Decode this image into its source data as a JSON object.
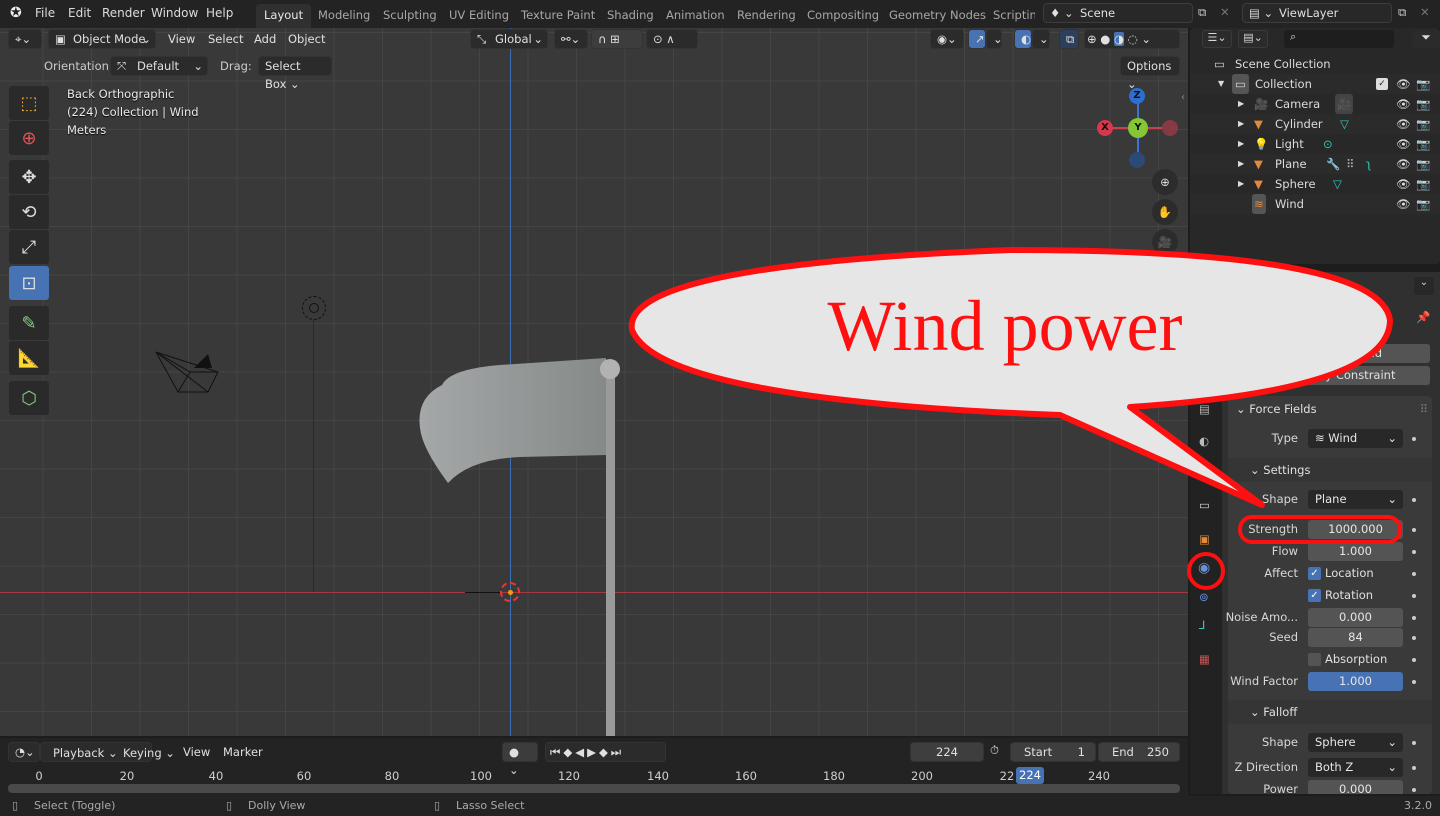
{
  "topbar": {
    "menus": [
      "File",
      "Edit",
      "Render",
      "Window",
      "Help"
    ],
    "workspaces": [
      "Layout",
      "Modeling",
      "Sculpting",
      "UV Editing",
      "Texture Paint",
      "Shading",
      "Animation",
      "Rendering",
      "Compositing",
      "Geometry Nodes",
      "Scripting"
    ],
    "active_workspace": "Layout",
    "scene": "Scene",
    "view_layer": "ViewLayer"
  },
  "viewport_header": {
    "mode": "Object Mode",
    "menus": [
      "View",
      "Select",
      "Add",
      "Object"
    ],
    "transform_orientation": "Global",
    "orientation_label": "Orientation:",
    "orientation_value": "Default",
    "drag_label": "Drag:",
    "drag_value": "Select Box",
    "options": "Options"
  },
  "viewport_overlay": {
    "view_name": "Back Orthographic",
    "context": "(224) Collection | Wind",
    "units": "Meters"
  },
  "gizmo": {
    "z": "Z",
    "y": "Y",
    "x": "X"
  },
  "callout": {
    "text": "Wind power",
    "color": "#ff1010"
  },
  "outliner": {
    "root": "Scene Collection",
    "collection": "Collection",
    "objects": [
      {
        "name": "Camera",
        "type": "camera"
      },
      {
        "name": "Cylinder",
        "type": "mesh"
      },
      {
        "name": "Light",
        "type": "light"
      },
      {
        "name": "Plane",
        "type": "mesh"
      },
      {
        "name": "Sphere",
        "type": "mesh"
      },
      {
        "name": "Wind",
        "type": "force"
      }
    ]
  },
  "properties": {
    "buttons": [
      "Field",
      "Rigid Body Constraint"
    ],
    "panel": "Force Fields",
    "type_label": "Type",
    "type_value": "Wind",
    "settings_label": "Settings",
    "shape_label": "Shape",
    "shape_value": "Plane",
    "strength_label": "Strength",
    "strength_value": "1000.000",
    "flow_label": "Flow",
    "flow_value": "1.000",
    "affect_label": "Affect",
    "affect_location": "Location",
    "affect_rotation": "Rotation",
    "noise_label": "Noise Amo...",
    "noise_value": "0.000",
    "seed_label": "Seed",
    "seed_value": "84",
    "absorption_label": "Absorption",
    "wind_factor_label": "Wind Factor",
    "wind_factor_value": "1.000",
    "falloff_label": "Falloff",
    "falloff_shape_label": "Shape",
    "falloff_shape_value": "Sphere",
    "zdir_label": "Z Direction",
    "zdir_value": "Both Z",
    "power_label": "Power",
    "power_value": "0.000"
  },
  "timeline": {
    "menus": [
      "Playback",
      "Keying",
      "View",
      "Marker"
    ],
    "current_frame": "224",
    "start_label": "Start",
    "start_value": "1",
    "end_label": "End",
    "end_value": "250",
    "ticks": [
      "0",
      "20",
      "40",
      "60",
      "80",
      "100",
      "120",
      "140",
      "160",
      "180",
      "200",
      "22",
      "240"
    ],
    "playhead": "224"
  },
  "statusbar": {
    "hints": [
      "Select (Toggle)",
      "Dolly View",
      "Lasso Select"
    ],
    "version": "3.2.0"
  }
}
